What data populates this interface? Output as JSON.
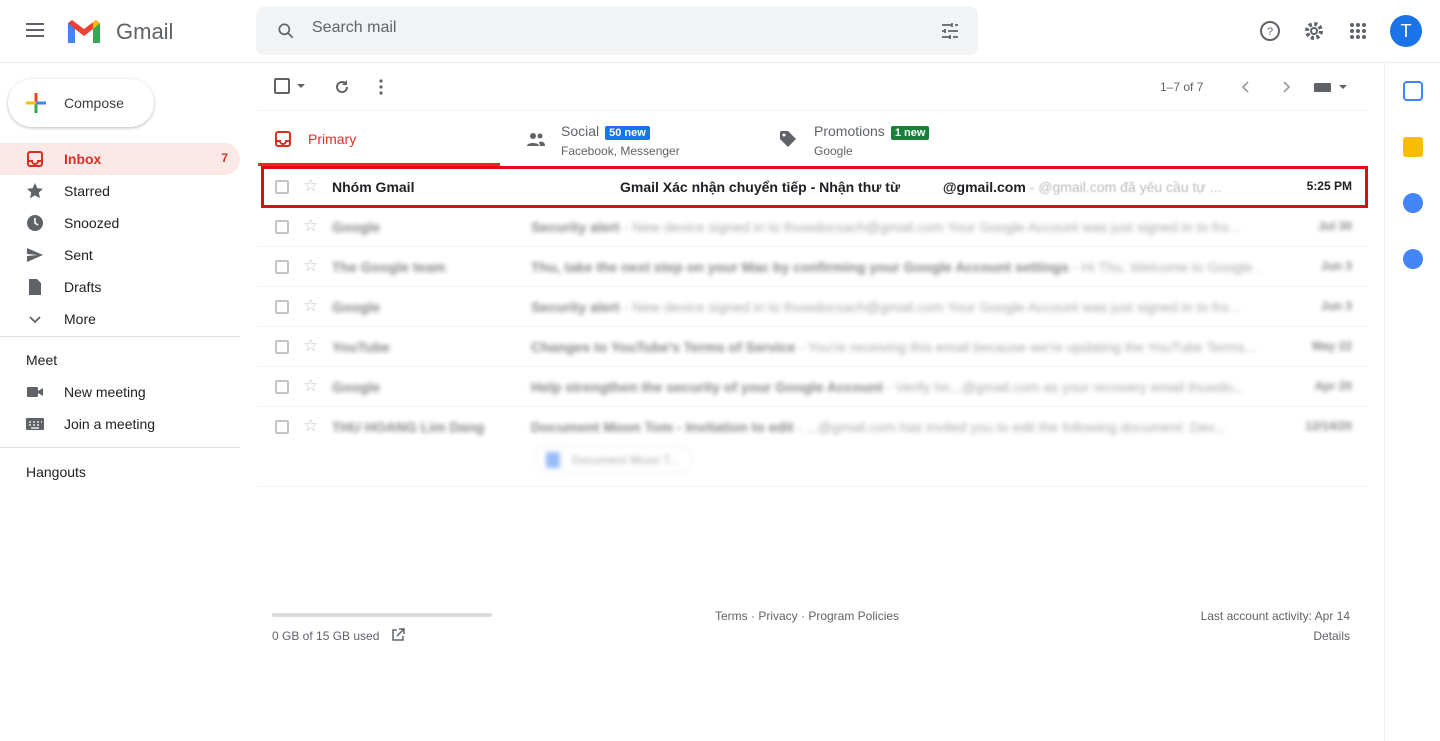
{
  "header": {
    "app_name": "Gmail",
    "search_placeholder": "Search mail",
    "avatar_letter": "T"
  },
  "compose": {
    "label": "Compose"
  },
  "sidebar": {
    "items": [
      {
        "label": "Inbox",
        "count": "7",
        "icon": "inbox-icon",
        "active": true
      },
      {
        "label": "Starred",
        "icon": "star-icon"
      },
      {
        "label": "Snoozed",
        "icon": "clock-icon"
      },
      {
        "label": "Sent",
        "icon": "send-icon"
      },
      {
        "label": "Drafts",
        "icon": "draft-icon"
      },
      {
        "label": "More",
        "icon": "chevron-down-icon"
      }
    ],
    "meet": {
      "title": "Meet",
      "items": [
        {
          "label": "New meeting",
          "icon": "video-icon"
        },
        {
          "label": "Join a meeting",
          "icon": "keyboard-icon"
        }
      ]
    },
    "hangouts": "Hangouts"
  },
  "toolbar": {
    "pagination": "1–7 of 7"
  },
  "tabs": [
    {
      "label": "Primary",
      "color": "#d93025"
    },
    {
      "label": "Social",
      "badge": "50 new",
      "badge_color": "#1a73e8",
      "sub": "Facebook, Messenger"
    },
    {
      "label": "Promotions",
      "badge": "1 new",
      "badge_color": "#188038",
      "sub": "Google"
    }
  ],
  "emails": [
    {
      "from": "Nhóm Gmail",
      "subject": "Gmail Xác nhận chuyển tiếp - Nhận thư từ",
      "subject2": "@gmail.com",
      "snippet": " - @gmail.com đã yêu cầu tự ...",
      "date": "5:25 PM"
    },
    {
      "from": "Google",
      "subject": "Security alert",
      "snippet": " - New device signed in to thuwdocsach@gmail.com Your Google Account was just signed in to fro...",
      "date": "Jul 30"
    },
    {
      "from": "The Google team",
      "subject": "Thu, take the next step on your Mac by confirming your Google Account settings",
      "snippet": " - Hi Thu, Welcome to Google ...",
      "date": "Jun 3"
    },
    {
      "from": "Google",
      "subject": "Security alert",
      "snippet": " - New device signed in to thuwdocsach@gmail.com Your Google Account was just signed in to fro...",
      "date": "Jun 3"
    },
    {
      "from": "YouTube",
      "subject": "Changes to YouTube's Terms of Service",
      "snippet": " - You're receiving this email because we're updating the YouTube Terms...",
      "date": "May 22"
    },
    {
      "from": "Google",
      "subject": "Help strengthen the security of your Google Account",
      "snippet": " - Verify hn...@gmail.com as your recovery email thuwdo...",
      "date": "Apr 20"
    },
    {
      "from": "THU HOANG Lim Dang",
      "subject": "Document Moon Tom - Invitation to edit",
      "snippet": " - ...@gmail.com has invited you to edit the following document: Dev...",
      "date": "12/14/20",
      "attachment": "Document Moon T..."
    }
  ],
  "footer": {
    "storage": "0 GB of 15 GB used",
    "storage_fraction": 0,
    "links": "Terms · Privacy · Program Policies",
    "activity": "Last account activity: Apr 14",
    "details": "Details"
  },
  "colors": {
    "accent": "#d93025",
    "highlight_box": "#e50914"
  }
}
